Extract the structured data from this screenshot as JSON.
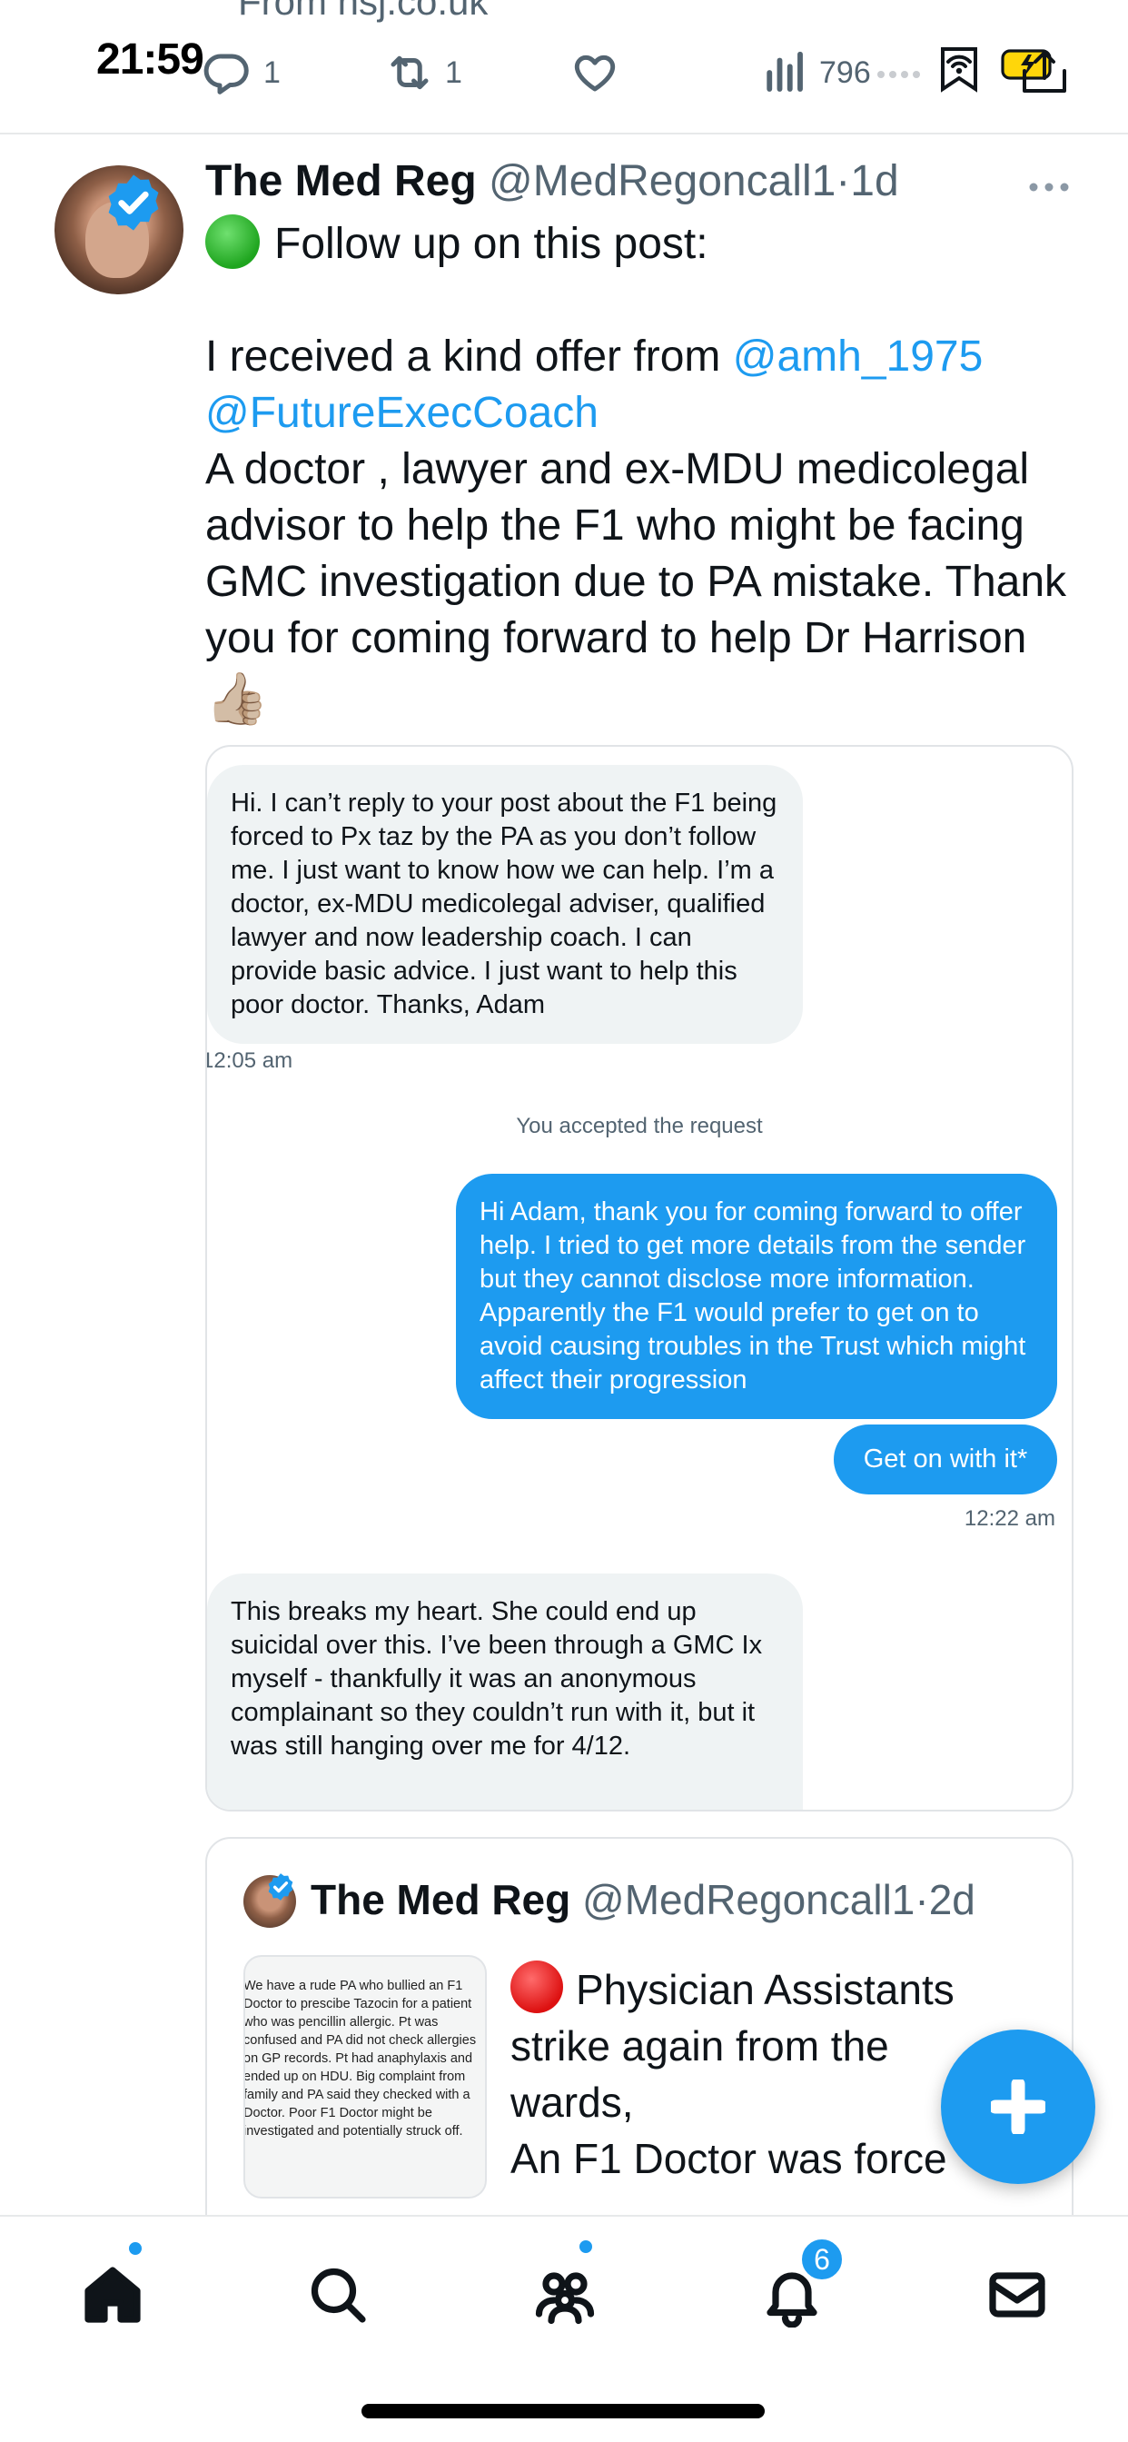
{
  "topbar": {
    "prev_source": "From nsj.co.uk",
    "clock": "21:59",
    "reply_count": "1",
    "repost_count": "1",
    "views_count": "796"
  },
  "tweet": {
    "author_name": "The Med Reg",
    "author_handle": "@MedRegoncall1",
    "separator": "·",
    "time": "1d",
    "line1": "Follow up on this post:",
    "line2_pre": "I received a kind offer from ",
    "mention1": "@amh_1975",
    "mention2": "@FutureExecCoach",
    "body": "A doctor , lawyer and ex-MDU medicolegal advisor to help the F1 who might be facing GMC investigation due to PA mistake. Thank you for coming forward to help Dr Harrison",
    "emoji": "👍🏼"
  },
  "dm": {
    "msg1": "Hi. I can’t reply to your post about the F1 being forced to Px taz by the PA as you don’t follow me. I just want to know how we can help. I’m a doctor, ex-MDU medicolegal adviser, qualified lawyer and now leadership coach. I can provide basic advice. I just want to help this poor doctor. Thanks, Adam",
    "time1": "12:05 am",
    "accepted": "You accepted the request",
    "msg2": "Hi Adam, thank you for coming forward to offer help. I tried to get more details from the sender but they cannot disclose more information. Apparently the F1 would prefer to get on to avoid causing troubles in the Trust which might affect their progression",
    "msg3": "Get on with it*",
    "time2": "12:22 am",
    "msg4": "This breaks my heart. She could end up suicidal over this. I’ve been through a GMC Ix myself - thankfully it was an anonymous complainant so they couldn’t run with it, but it was still hanging over me for 4/12."
  },
  "quote": {
    "author_name": "The Med Reg",
    "author_handle": "@MedRegoncall1",
    "separator": "·",
    "time": "2d",
    "thumb_text": "We have a rude PA who bullied an F1 Doctor to prescibe Tazocin for a patient who was pencillin allergic. Pt was confused and PA did not check allergies on GP records. Pt had anaphylaxis and ended up on HDU. Big complaint from family and PA said they checked with a Doctor. Poor F1 Doctor might be investigated and potentially struck off.",
    "line1": "Physician Assistants",
    "line2": "strike again from the",
    "line3": "wards,",
    "line4": "An F1 Doctor was force"
  },
  "nav": {
    "notifications_badge": "6"
  },
  "colors": {
    "accent": "#1d9bf0",
    "text": "#0f1419",
    "secondary": "#536471"
  }
}
